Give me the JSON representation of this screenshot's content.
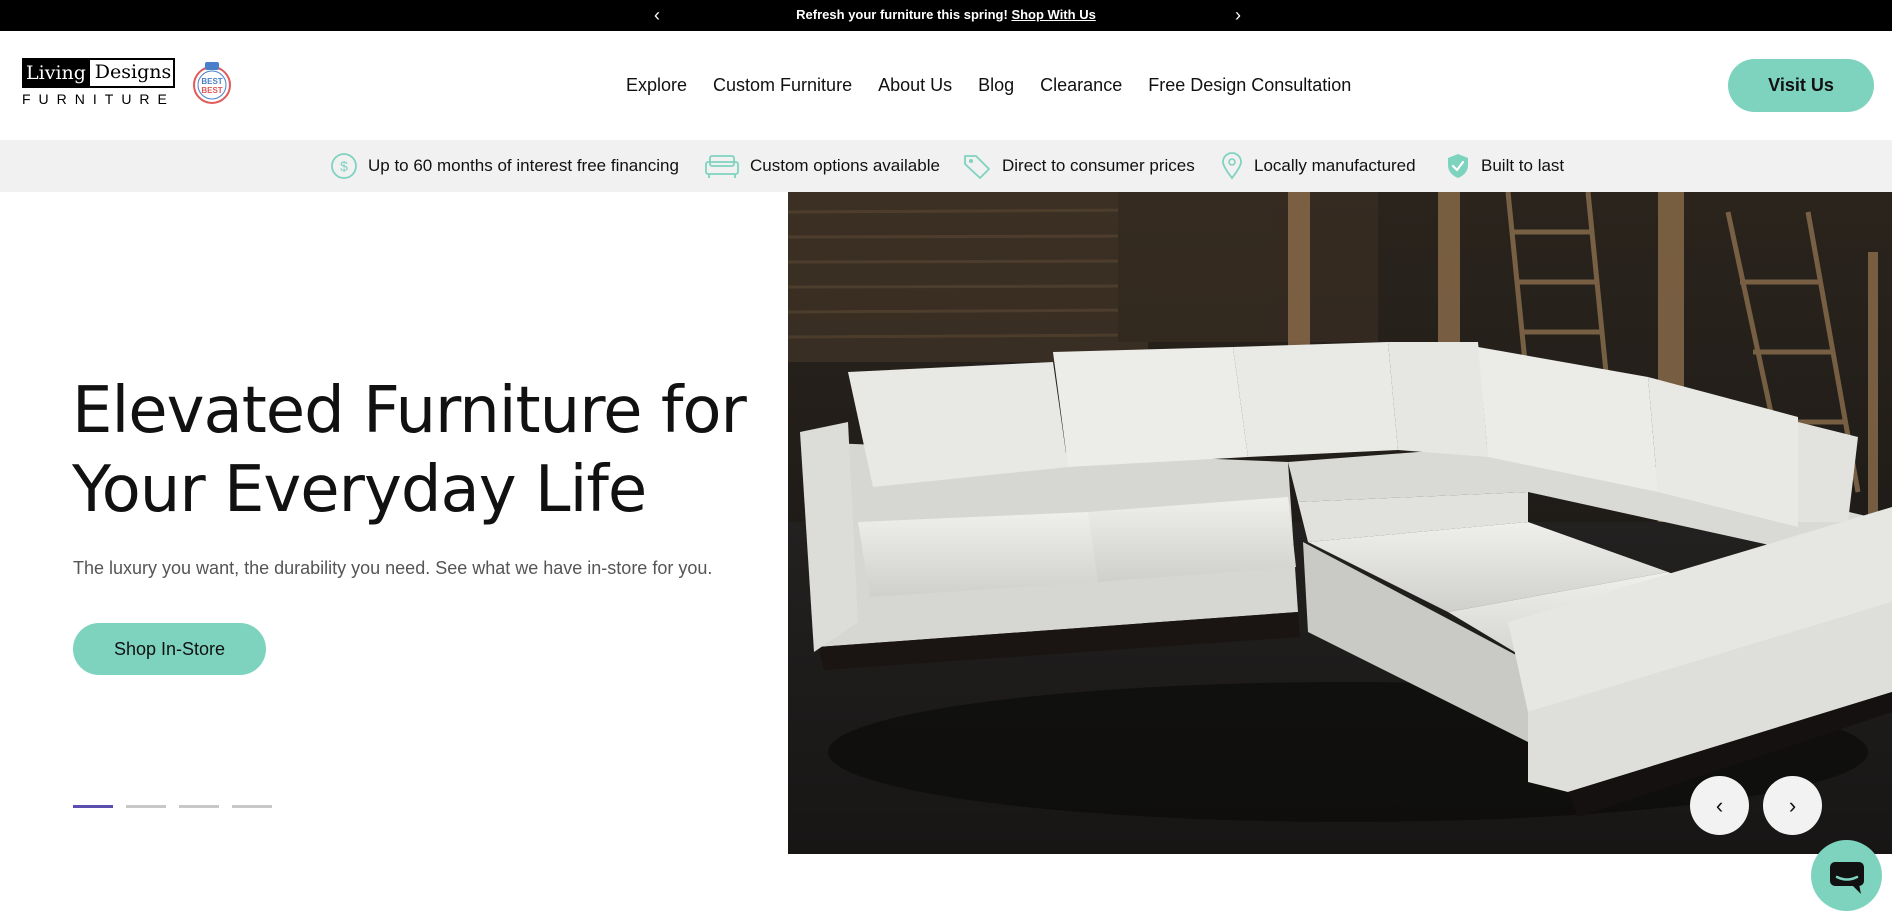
{
  "announcement": {
    "message": "Refresh your furniture this spring!",
    "link": "Shop With Us",
    "prev_icon": "chevron-left-icon",
    "next_icon": "chevron-right-icon"
  },
  "header": {
    "logo": {
      "word1": "Living",
      "word2": "Designs",
      "word3": "FURNITURE"
    },
    "badge": {
      "line1": "BEST",
      "line2": "BEST"
    },
    "nav": [
      "Explore",
      "Custom Furniture",
      "About Us",
      "Blog",
      "Clearance",
      "Free Design Consultation"
    ],
    "visit_button": "Visit Us"
  },
  "features": [
    {
      "icon": "dollar-icon",
      "label": "Up to 60 months of interest free financing"
    },
    {
      "icon": "sofa-icon",
      "label": "Custom options available"
    },
    {
      "icon": "tag-icon",
      "label": "Direct to consumer prices"
    },
    {
      "icon": "location-pin-icon",
      "label": "Locally manufactured"
    },
    {
      "icon": "shield-check-icon",
      "label": "Built to last"
    }
  ],
  "hero": {
    "title_line1": "Elevated Furniture for",
    "title_line2": "Your Everyday Life",
    "subtitle": "The luxury you want, the durability you need. See what we have in-store for you.",
    "button": "Shop In-Store",
    "slides": 4,
    "active_slide": 1,
    "prev_icon": "chevron-left-icon",
    "next_icon": "chevron-right-icon"
  },
  "colors": {
    "accent": "#7ed3bf",
    "active_dot": "#5a4fb1",
    "feature_bar": "#f1f1f1"
  },
  "chat": {
    "icon": "chat-bubble-icon"
  }
}
